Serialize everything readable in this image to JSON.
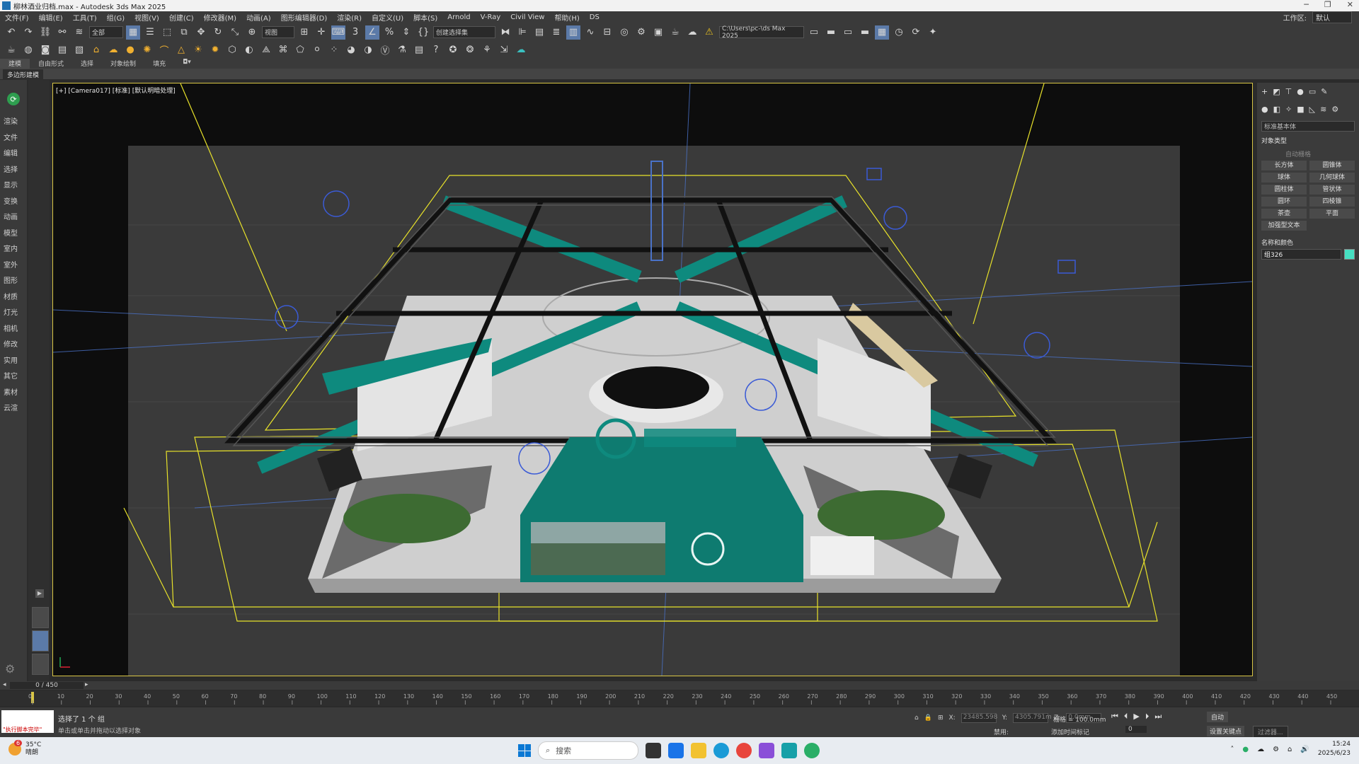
{
  "window": {
    "title": "柳林酒业归档.max - Autodesk 3ds Max 2025",
    "workspace_label": "工作区:",
    "workspace_value": "默认"
  },
  "menu": [
    "文件(F)",
    "编辑(E)",
    "工具(T)",
    "组(G)",
    "视图(V)",
    "创建(C)",
    "修改器(M)",
    "动画(A)",
    "图形编辑器(D)",
    "渲染(R)",
    "自定义(U)",
    "脚本(S)",
    "Arnold",
    "V-Ray",
    "Civil View",
    "帮助(H)",
    "DS"
  ],
  "toolbar": {
    "filter_dropdown": "全部",
    "refcoord_dropdown": "视图",
    "selection_set": "创建选择集",
    "path_field": "C:\\Users\\pc-\\ds Max 2025"
  },
  "ribbon_tabs": [
    "建模",
    "自由形式",
    "选择",
    "对象绘制",
    "填充"
  ],
  "ribbon_active": "建模",
  "subtab": "多边形建模",
  "left_panel": [
    "渲染",
    "文件",
    "编辑",
    "选择",
    "显示",
    "变换",
    "动画",
    "模型",
    "室内",
    "室外",
    "图形",
    "材质",
    "灯光",
    "相机",
    "修改",
    "实用",
    "其它",
    "素材",
    "云渲"
  ],
  "viewport": {
    "label": "[+] [Camera017] [标准] [默认明暗处理]"
  },
  "command_panel": {
    "category_dropdown": "标准基本体",
    "object_type_title": "对象类型",
    "autogrid": "自动栅格",
    "object_buttons": [
      "长方体",
      "圆锥体",
      "球体",
      "几何球体",
      "圆柱体",
      "管状体",
      "圆环",
      "四棱锥",
      "茶壶",
      "平面",
      "加强型文本"
    ],
    "name_color_title": "名称和颜色",
    "object_name": "组326",
    "object_color": "#46e0c2"
  },
  "timeline": {
    "frame_display": "0 / 450",
    "ticks": [
      0,
      10,
      20,
      30,
      40,
      50,
      60,
      70,
      80,
      90,
      100,
      110,
      120,
      130,
      140,
      150,
      160,
      170,
      180,
      190,
      200,
      210,
      220,
      230,
      240,
      250,
      260,
      270,
      280,
      290,
      300,
      310,
      320,
      330,
      340,
      350,
      360,
      370,
      380,
      390,
      400,
      410,
      420,
      430,
      440,
      450
    ]
  },
  "status": {
    "maxscript_text": "\"执行脚本完毕\"",
    "selection": "选择了 1 个 组",
    "prompt": "单击或单击并拖动以选择对象",
    "x_label": "X:",
    "y_label": "Y:",
    "z_label": "Z:",
    "x_value": "23485.598",
    "y_value": "4305.791m",
    "z_value": "0.0mm",
    "grid": "栅格 = 100.0mm",
    "auto_key": "自动",
    "set_key": "设置关键点",
    "key_filter": "过滤器...",
    "disabled_label": "禁用:",
    "add_tag": "添加时间标记",
    "current_frame": "0"
  },
  "taskbar": {
    "temperature": "35°C",
    "weather": "晴朗",
    "search_placeholder": "搜索",
    "time": "15:24",
    "date": "2025/6/23",
    "badge": "6"
  },
  "colors": {
    "viewport_border": "#d8c545",
    "accent_teal": "#0e8a7e",
    "truss": "#1a1a1a",
    "helpers": "#3b5bd6",
    "selection_yellow": "#e8e22a"
  }
}
